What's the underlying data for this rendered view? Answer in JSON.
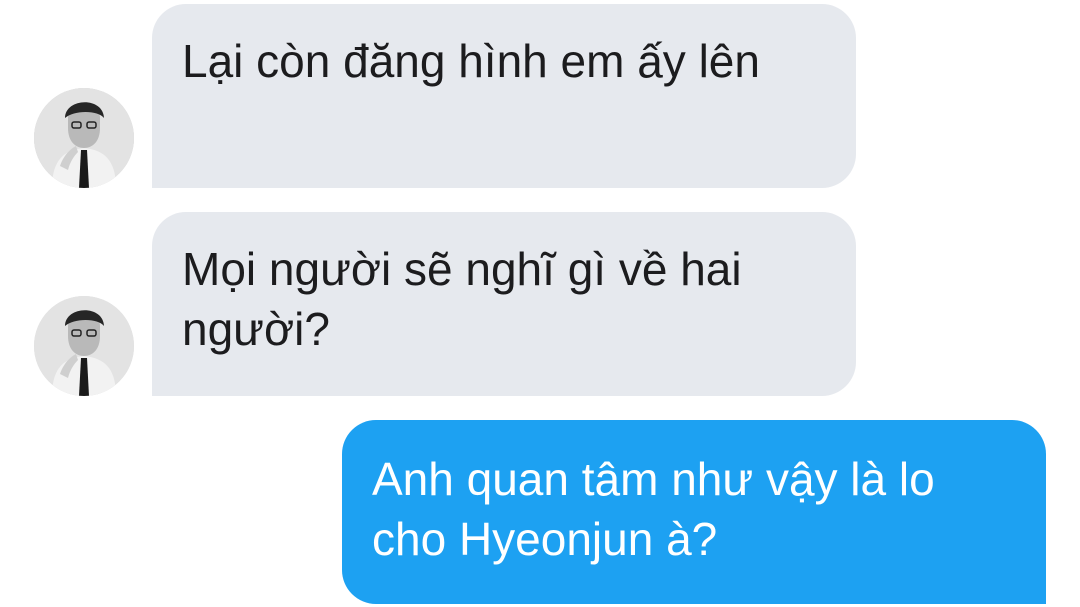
{
  "messages": [
    {
      "direction": "incoming",
      "text": "Lại còn đăng hình em ấy lên",
      "avatar_icon": "user-avatar-icon"
    },
    {
      "direction": "incoming",
      "text": "Mọi người sẽ nghĩ gì về hai người?",
      "avatar_icon": "user-avatar-icon"
    },
    {
      "direction": "outgoing",
      "text": "Anh quan tâm như vậy là lo cho Hyeonjun à?"
    }
  ],
  "colors": {
    "incoming_bubble": "#e6e9ee",
    "outgoing_bubble": "#1da1f2",
    "incoming_text": "#1c1c1e",
    "outgoing_text": "#ffffff",
    "background": "#ffffff"
  }
}
